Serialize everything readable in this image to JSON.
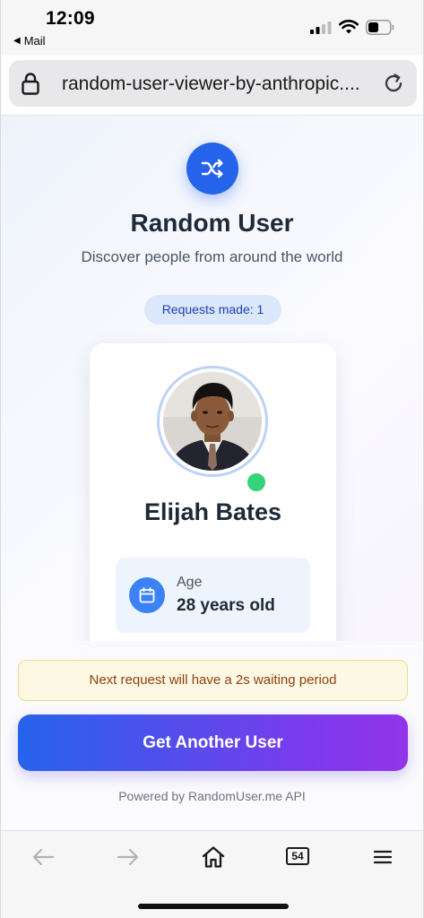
{
  "status_bar": {
    "time": "12:09",
    "back_app": "Mail",
    "back_glyph": "◀"
  },
  "browser": {
    "url": "random-user-viewer-by-anthropic....",
    "tab_count": "54"
  },
  "app": {
    "title": "Random User",
    "subtitle": "Discover people from around the world",
    "requests_label": "Requests made: 1",
    "user": {
      "name": "Elijah Bates",
      "age_label": "Age",
      "age_value": "28 years old"
    },
    "notice": "Next request will have a 2s waiting period",
    "button_label": "Get Another User",
    "footer": "Powered by RandomUser.me API"
  },
  "colors": {
    "accent": "#2563eb",
    "button_gradient_end": "#9333ea",
    "online": "#34d37a",
    "notice_bg": "#fdf8e3"
  },
  "icons": [
    "lock-icon",
    "reload-icon",
    "shuffle-icon",
    "calendar-icon",
    "back-arrow-icon",
    "forward-arrow-icon",
    "home-icon",
    "tabs-icon",
    "menu-icon"
  ]
}
